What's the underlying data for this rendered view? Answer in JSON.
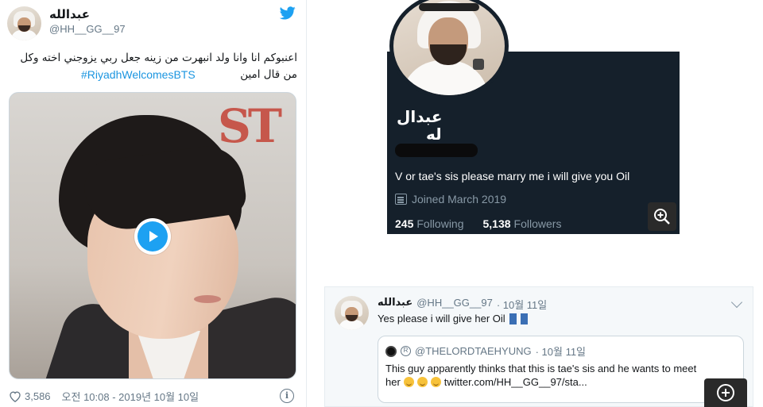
{
  "colors": {
    "twitter_blue": "#1da1f2",
    "link_blue": "#1b95e0",
    "dark_card": "#15202b",
    "secondary_text": "#657786"
  },
  "left_tweet": {
    "display_name": "عبدالله",
    "handle": "@HH__GG__97",
    "text": "اعنبوكم انا وانا ولد انبهرت من زينه جعل ربي يزوجني اخته وكل من قال امين",
    "hashtag": "#RiyadhWelcomesBTS",
    "likes": "3,586",
    "timestamp": "오전 10:08 - 2019년 10월 10일",
    "icons": {
      "brand": "twitter-bird-icon",
      "like": "heart-icon",
      "info": "info-icon",
      "media": "play-icon"
    }
  },
  "profile_card": {
    "name_line1": "عبدال",
    "name_line2": "له",
    "bio": "V or tae's sis please marry me i will give you Oil",
    "joined": "Joined March 2019",
    "following_count": "245",
    "following_label": "Following",
    "followers_count": "5,138",
    "followers_label": "Followers"
  },
  "reply_tweet": {
    "display_name": "عبدالله",
    "handle": "@HH__GG__97",
    "date": "· 10월 11일",
    "text": "Yes please i will give her Oil",
    "quoted": {
      "handle": "@THELORDTAEHYUNG",
      "date": "· 10월 11일",
      "line1": "This guy apparently thinks that this is tae's sis and he wants to meet",
      "line2_prefix": "her",
      "line2_link": "twitter.com/HH__GG__97/sta..."
    }
  }
}
